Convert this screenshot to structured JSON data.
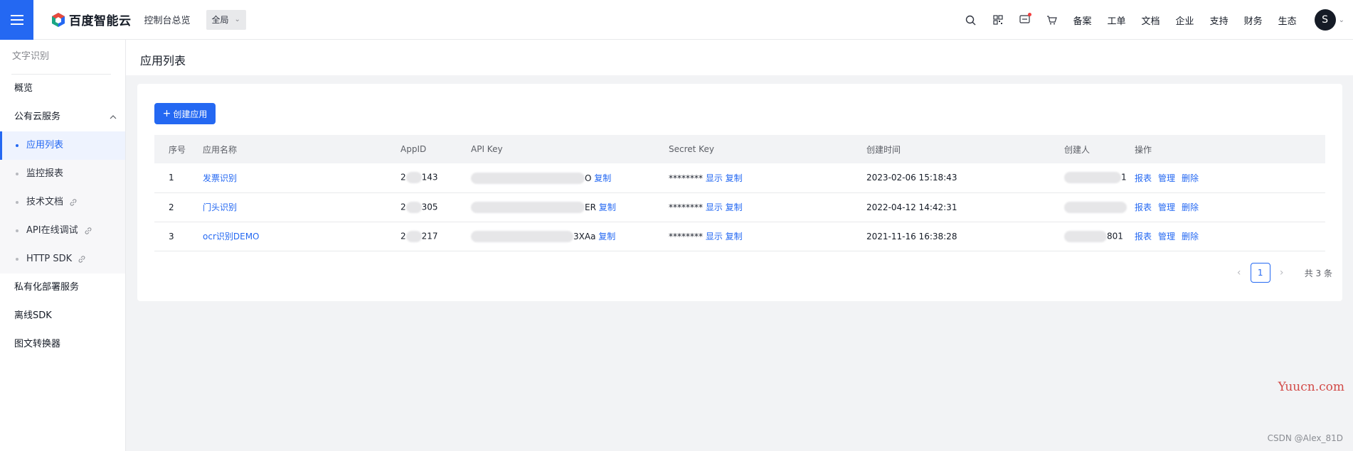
{
  "header": {
    "brand": "百度智能云",
    "overview": "控制台总览",
    "region": "全局",
    "links": [
      "备案",
      "工单",
      "文档",
      "企业",
      "支持",
      "财务",
      "生态"
    ],
    "avatar_letter": "S"
  },
  "sidebar": {
    "title": "文字识别",
    "overview": "概览",
    "public_group": "公有云服务",
    "sub": [
      "应用列表",
      "监控报表",
      "技术文档",
      "API在线调试",
      "HTTP SDK"
    ],
    "private_deploy": "私有化部署服务",
    "offline_sdk": "离线SDK",
    "converter": "图文转换器"
  },
  "page": {
    "title": "应用列表",
    "create_label": "创建应用"
  },
  "table": {
    "columns": [
      "序号",
      "应用名称",
      "AppID",
      "API Key",
      "Secret Key",
      "创建时间",
      "创建人",
      "操作"
    ],
    "rows": [
      {
        "no": "1",
        "name": "发票识别",
        "appid_a": "2",
        "appid_b": "143",
        "apikey_tail": "O",
        "secret": "********",
        "created": "2023-02-06 15:18:43",
        "creator_tail": "1"
      },
      {
        "no": "2",
        "name": "门头识别",
        "appid_a": "2",
        "appid_b": "305",
        "apikey_tail": "ER",
        "secret": "********",
        "created": "2022-04-12 14:42:31",
        "creator_tail": ""
      },
      {
        "no": "3",
        "name": "ocr识别DEMO",
        "appid_a": "2",
        "appid_b": "217",
        "apikey_tail": "3XAa",
        "secret": "********",
        "created": "2021-11-16 16:38:28",
        "creator_tail": "801"
      }
    ],
    "copy": "复制",
    "show": "显示",
    "op_report": "报表",
    "op_manage": "管理",
    "op_delete": "删除"
  },
  "pagination": {
    "current": "1",
    "total": "共 3 条"
  },
  "watermark": {
    "site": "Yuucn.com",
    "author": "CSDN @Alex_81D"
  },
  "colors": {
    "accent": "#2468f2",
    "notify_dot": "#f33e3e"
  }
}
